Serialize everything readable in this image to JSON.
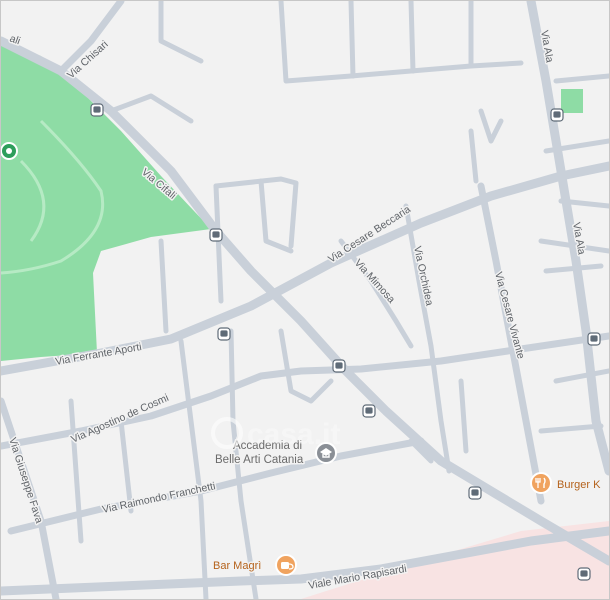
{
  "map": {
    "watermark": "casa.it",
    "colors": {
      "background": "#f2f2f2",
      "road": "#c9d0d9",
      "park": "#8edca5",
      "poi_orange": "#f0a35f",
      "label": "#5f6368"
    },
    "streets": {
      "via_chisari": "Via Chisari",
      "via_cifali": "Via Cifali",
      "via_ala": "Via Ala",
      "via_ala_2": "Via Ala",
      "via_cesare_beccaria": "Via Cesare Beccaria",
      "via_mimosa": "Via Mimosa",
      "via_orchidea": "Via Orchidea",
      "via_cesare_vivante": "Via Cesare Vivante",
      "via_ferrante_aporti": "Via Ferrante Aporti",
      "via_agostino_de_cosmi": "Via Agostino de Cosmi",
      "via_giuseppe_fava": "Via Giuseppe Fava",
      "via_raimondo_franchetti": "Via Raimondo Franchetti",
      "viale_mario_rapisardi": "Viale Mario Rapisardi",
      "via_cifali_top": "ali"
    },
    "pois": {
      "accademia_line1": "Accademia di",
      "accademia_line2": "Belle Arti Catania",
      "bar_magri": "Bar Magrì",
      "burger": "Burger K"
    },
    "icons": {
      "bus_stop": "bus-stop-icon",
      "school": "school-icon",
      "cafe": "cafe-icon",
      "restaurant": "restaurant-icon",
      "park_poi": "park-poi-icon"
    }
  }
}
